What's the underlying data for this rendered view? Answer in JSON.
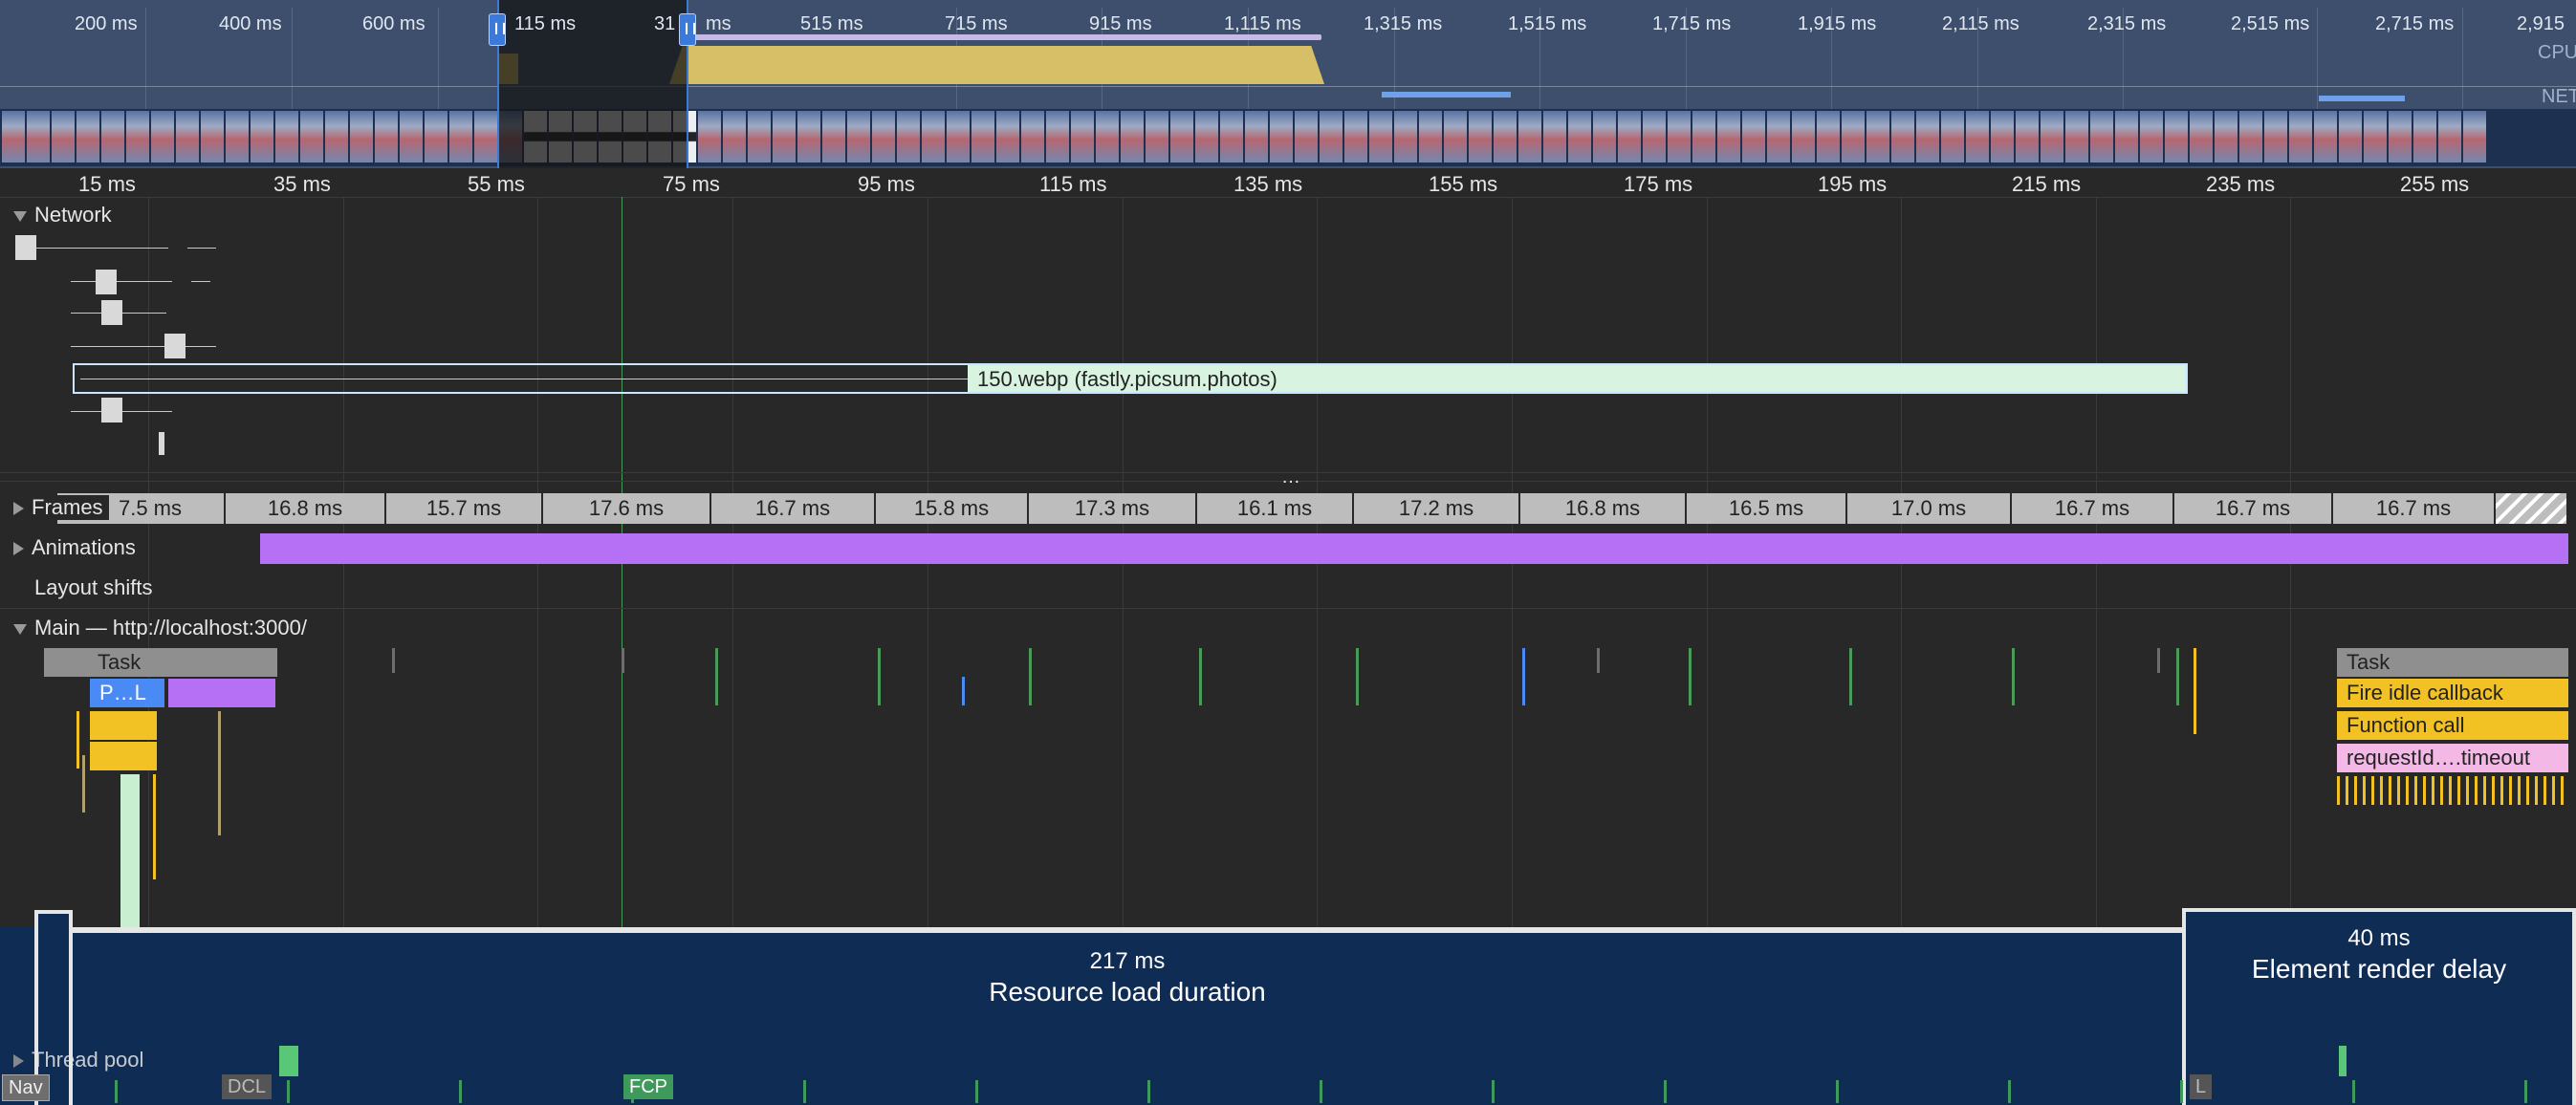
{
  "overview": {
    "time_labels": [
      "200 ms",
      "400 ms",
      "600 ms",
      "115 ms",
      "31",
      "ms",
      "515 ms",
      "715 ms",
      "915 ms",
      "1,115 ms",
      "1,315 ms",
      "1,515 ms",
      "1,715 ms",
      "1,915 ms",
      "2,115 ms",
      "2,315 ms",
      "2,515 ms",
      "2,715 ms",
      "2,915"
    ],
    "cpu_label": "CPU",
    "net_label": "NET"
  },
  "ruler": [
    "15 ms",
    "35 ms",
    "55 ms",
    "75 ms",
    "95 ms",
    "115 ms",
    "135 ms",
    "155 ms",
    "175 ms",
    "195 ms",
    "215 ms",
    "235 ms",
    "255 ms"
  ],
  "tracks": {
    "network": "Network",
    "network_request": "150.webp (fastly.picsum.photos)",
    "frames": "Frames",
    "animations": "Animations",
    "layout_shifts": "Layout shifts",
    "main": "Main — http://localhost:3000/",
    "thread_pool": "Thread pool",
    "more": "…"
  },
  "frames": [
    "7.5 ms",
    "16.8 ms",
    "15.7 ms",
    "17.6 ms",
    "16.7 ms",
    "15.8 ms",
    "17.3 ms",
    "16.1 ms",
    "17.2 ms",
    "16.8 ms",
    "16.5 ms",
    "17.0 ms",
    "16.7 ms",
    "16.7 ms",
    "16.7 ms"
  ],
  "flame_left": {
    "task": "Task",
    "parse": "P…L"
  },
  "flame_right": {
    "task": "Task",
    "fire_idle": "Fire idle callback",
    "function_call": "Function call",
    "request_timeout": "requestId….timeout"
  },
  "overlays": {
    "resource": {
      "value": "217 ms",
      "label": "Resource load duration"
    },
    "render": {
      "value": "40 ms",
      "label": "Element render delay"
    }
  },
  "markers": {
    "nav": "Nav",
    "dcl": "DCL",
    "fcp": "FCP",
    "l": "L"
  },
  "colors": {
    "task_grey": "#8f8f8f",
    "scripting_yellow": "#f2c224",
    "rendering_purple": "#b570f5",
    "loading_blue": "#4a8af4",
    "painting_green": "#5ac778",
    "overlay_navy": "#0f2c55",
    "network_bar": "#d8f3e0"
  }
}
